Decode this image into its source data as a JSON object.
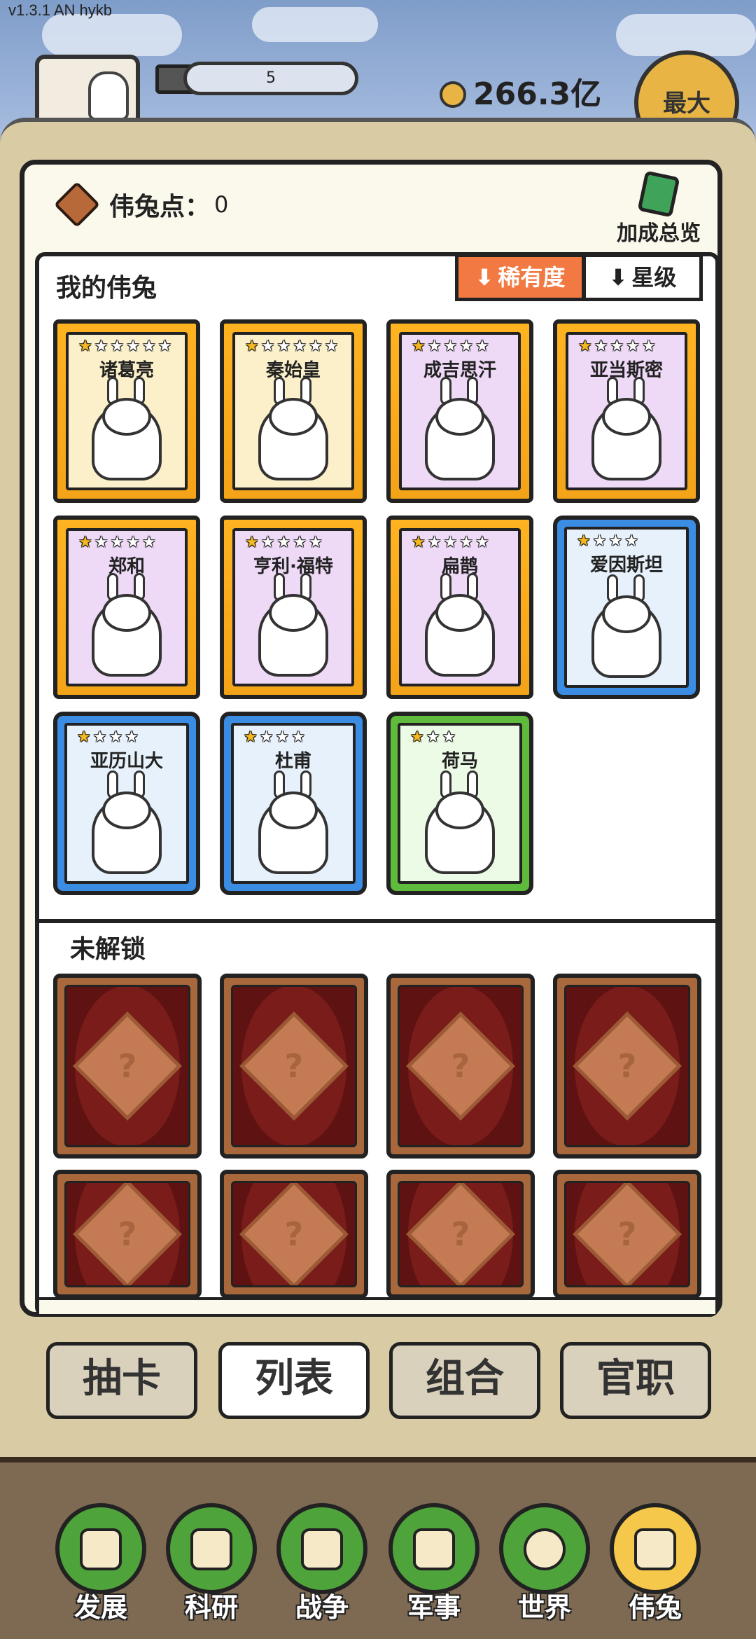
{
  "status": {
    "version": "v1.3.1 AN hykb"
  },
  "header": {
    "level_value": "5",
    "coin_amount": "266.3亿",
    "max_label": "最大"
  },
  "points": {
    "label": "伟兔点：",
    "value": "0"
  },
  "bonus": {
    "label": "加成总览"
  },
  "my_cards": {
    "title": "我的伟兔",
    "sort_rarity": "稀有度",
    "sort_star": "星级",
    "cards": [
      {
        "name": "诸葛亮",
        "stars": 6,
        "lit": 1,
        "frame": "gold-yellow"
      },
      {
        "name": "秦始皇",
        "stars": 6,
        "lit": 1,
        "frame": "gold-yellow"
      },
      {
        "name": "成吉思汗",
        "stars": 5,
        "lit": 1,
        "frame": "gold"
      },
      {
        "name": "亚当斯密",
        "stars": 5,
        "lit": 1,
        "frame": "gold"
      },
      {
        "name": "郑和",
        "stars": 5,
        "lit": 1,
        "frame": "gold"
      },
      {
        "name": "亨利·福特",
        "stars": 5,
        "lit": 1,
        "frame": "gold"
      },
      {
        "name": "扁鹊",
        "stars": 5,
        "lit": 1,
        "frame": "gold"
      },
      {
        "name": "爱因斯坦",
        "stars": 4,
        "lit": 1,
        "frame": "blue"
      },
      {
        "name": "亚历山大",
        "stars": 4,
        "lit": 1,
        "frame": "blue"
      },
      {
        "name": "杜甫",
        "stars": 4,
        "lit": 1,
        "frame": "blue"
      },
      {
        "name": "荷马",
        "stars": 3,
        "lit": 1,
        "frame": "green"
      }
    ]
  },
  "locked": {
    "title": "未解锁",
    "placeholder": "?"
  },
  "tabs": [
    {
      "label": "抽卡"
    },
    {
      "label": "列表"
    },
    {
      "label": "组合"
    },
    {
      "label": "官职"
    }
  ],
  "nav": [
    {
      "label": "发展"
    },
    {
      "label": "科研"
    },
    {
      "label": "战争"
    },
    {
      "label": "军事"
    },
    {
      "label": "世界"
    },
    {
      "label": "伟兔"
    }
  ]
}
